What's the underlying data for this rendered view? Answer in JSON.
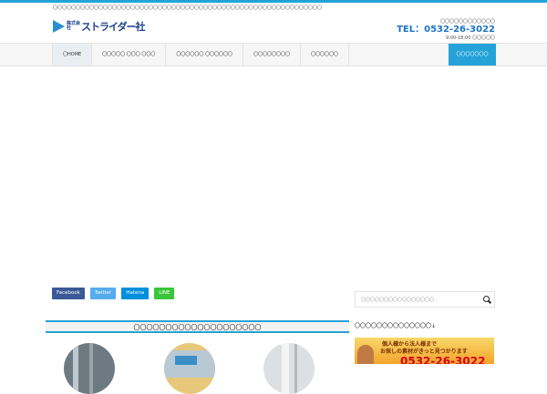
{
  "header": {
    "tagline": "〇〇〇〇〇〇〇〇〇〇〇〇〇〇〇〇〇〇〇〇〇〇〇〇〇〇〇〇〇〇〇〇〇〇〇〇〇〇〇〇〇〇〇〇〇〇〇〇〇〇〇〇〇〇〇〇〇〇〇",
    "logo_sub": "株式会社",
    "logo_name": "ストライダー社",
    "contact_label": "〇〇〇〇〇〇〇〇〇〇〇〇",
    "tel": "TEL：0532-26-3022",
    "hours": "9:00-18:00 〇〇〇〇〇"
  },
  "nav": {
    "items": [
      "〇HOME",
      "〇〇〇〇〇 〇〇〇 〇〇〇",
      "〇〇〇〇〇〇 〇〇〇〇〇〇",
      "〇〇〇〇〇〇〇〇",
      "〇〇〇〇〇〇"
    ],
    "cta": "〇〇〇〇〇〇〇"
  },
  "share": {
    "facebook": "Facebook",
    "twitter": "Twitter",
    "hatena": "Hatena",
    "line": "LINE"
  },
  "search": {
    "placeholder": "〇〇〇〇〇〇〇〇〇〇〇〇〇〇〇〇"
  },
  "main": {
    "section_title": "〇〇〇〇〇〇〇〇〇〇〇〇〇〇〇〇〇〇〇〇"
  },
  "sidebar": {
    "heading": "〇〇〇〇〇〇〇〇〇〇〇〇〇〇↓",
    "banner_line1": "個人様から法人様まで",
    "banner_line2": "お探しの素材がきっと見つかります",
    "banner_tel": "0532-26-3022"
  },
  "colors": {
    "accent": "#25a3d8",
    "brand": "#1c3f8f"
  }
}
